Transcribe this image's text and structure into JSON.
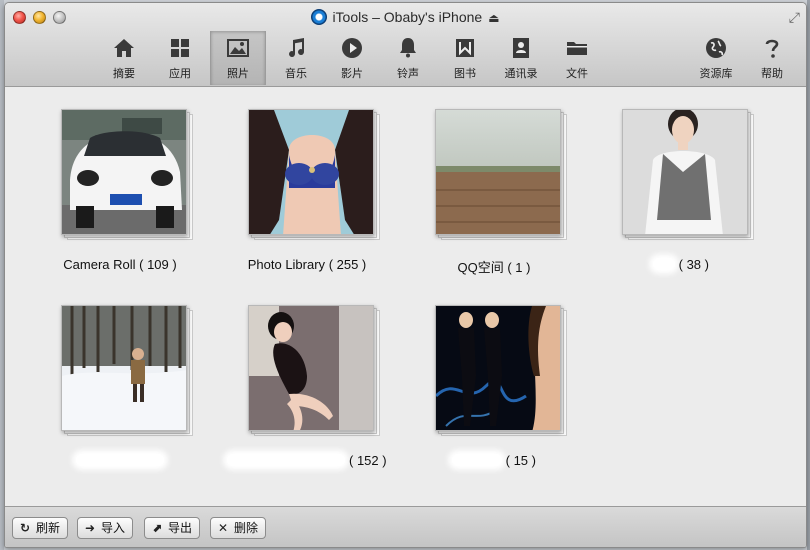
{
  "window": {
    "title": "iTools – Obaby's iPhone"
  },
  "toolbar": {
    "items": [
      {
        "label": "摘要",
        "icon": "home-icon"
      },
      {
        "label": "应用",
        "icon": "apps-icon"
      },
      {
        "label": "照片",
        "icon": "photo-icon",
        "active": true
      },
      {
        "label": "音乐",
        "icon": "music-icon"
      },
      {
        "label": "影片",
        "icon": "play-icon"
      },
      {
        "label": "铃声",
        "icon": "bell-icon"
      },
      {
        "label": "图书",
        "icon": "book-icon"
      },
      {
        "label": "通讯录",
        "icon": "contacts-icon"
      },
      {
        "label": "文件",
        "icon": "folder-icon"
      }
    ],
    "right_items": [
      {
        "label": "资源库",
        "icon": "globe-icon"
      },
      {
        "label": "帮助",
        "icon": "help-icon"
      }
    ]
  },
  "albums": [
    {
      "name": "Camera Roll",
      "count": "( 109 )"
    },
    {
      "name": "Photo Library",
      "count": "( 255 )"
    },
    {
      "name": "QQ空间",
      "count": "( 1 )"
    },
    {
      "name": "",
      "count": "( 38 )"
    },
    {
      "name": "",
      "count": ""
    },
    {
      "name": "",
      "count": "( 152 )"
    },
    {
      "name": "",
      "count": "( 15 )"
    }
  ],
  "bottom": {
    "refresh": "刷新",
    "import": "导入",
    "export": "导出",
    "delete": "删除"
  }
}
